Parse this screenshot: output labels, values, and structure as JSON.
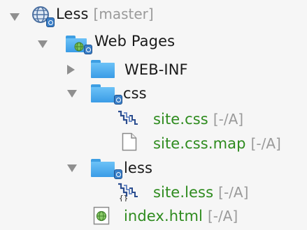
{
  "tree": {
    "items": [
      {
        "label": "Less",
        "suffix": "[master]",
        "icon": "globe-project-icon",
        "state": "expanded"
      },
      {
        "label": "Web Pages",
        "icon": "web-folder-icon",
        "state": "expanded"
      },
      {
        "label": "WEB-INF",
        "icon": "folder-icon",
        "state": "collapsed"
      },
      {
        "label": "css",
        "icon": "folder-icon",
        "state": "expanded"
      },
      {
        "label": "site.css",
        "suffix": "[-/A]",
        "icon": "css-file-icon",
        "status_color": "#2e8b1e"
      },
      {
        "label": "site.css.map",
        "suffix": "[-/A]",
        "icon": "blank-file-icon",
        "status_color": "#2e8b1e"
      },
      {
        "label": "less",
        "icon": "folder-icon",
        "state": "expanded"
      },
      {
        "label": "site.less",
        "suffix": "[-/A]",
        "icon": "less-file-icon",
        "status_color": "#2e8b1e"
      },
      {
        "label": "index.html",
        "suffix": "[-/A]",
        "icon": "html-file-icon",
        "status_color": "#2e8b1e"
      }
    ]
  }
}
